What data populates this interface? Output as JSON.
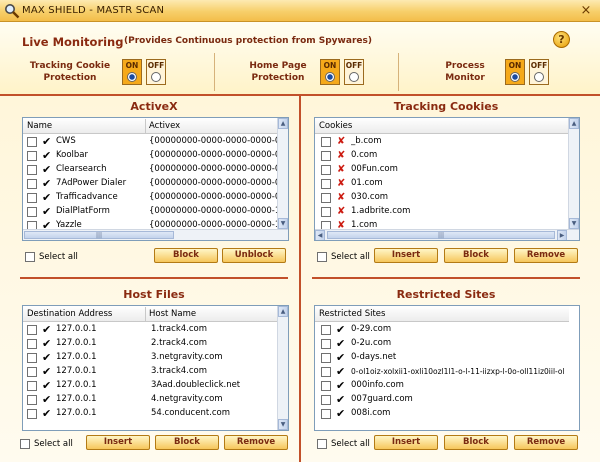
{
  "window": {
    "title": "MAX SHIELD - MASTR SCAN",
    "close_glyph": "×",
    "icon": "magnifier-icon"
  },
  "monitoring": {
    "title": "Live Monitoring",
    "subtitle": "(Provides Continuous protection from Spywares)",
    "help_glyph": "?",
    "toggles": [
      {
        "label_line1": "Tracking Cookie",
        "label_line2": "Protection",
        "on_label": "ON",
        "off_label": "OFF",
        "state": "on"
      },
      {
        "label_line1": "Home Page",
        "label_line2": "Protection",
        "on_label": "ON",
        "off_label": "OFF",
        "state": "on"
      },
      {
        "label_line1": "Process",
        "label_line2": "Monitor",
        "on_label": "ON",
        "off_label": "OFF",
        "state": "on"
      }
    ]
  },
  "activex": {
    "title": "ActiveX",
    "columns": [
      "Name",
      "Activex"
    ],
    "rows": [
      {
        "name": "CWS",
        "value": "{00000000-0000-0000-0000-000"
      },
      {
        "name": "Koolbar",
        "value": "{00000000-0000-0000-0000-000"
      },
      {
        "name": "Clearsearch",
        "value": "{00000000-0000-0000-0000-000"
      },
      {
        "name": "7AdPower Dialer",
        "value": "{00000000-0000-0000-0000-000"
      },
      {
        "name": "Trafficadvance",
        "value": "{00000000-0000-0000-0000-000"
      },
      {
        "name": "DialPlatForm",
        "value": "{00000000-0000-0000-0000-100"
      },
      {
        "name": "Yazzle",
        "value": "{00000000-0000-0000-0000-100"
      }
    ],
    "select_all": "Select all",
    "buttons": [
      "Block",
      "Unblock"
    ]
  },
  "cookies": {
    "title": "Tracking Cookies",
    "columns": [
      "Cookies"
    ],
    "rows": [
      "_b.com",
      "0.com",
      "00Fun.com",
      "01.com",
      "030.com",
      "1.adbrite.com",
      "1.com"
    ],
    "select_all": "Select all",
    "buttons": [
      "Insert",
      "Block",
      "Remove"
    ]
  },
  "hosts": {
    "title": "Host Files",
    "columns": [
      "Destination Address",
      "Host Name"
    ],
    "rows": [
      {
        "addr": "127.0.0.1",
        "host": "1.track4.com"
      },
      {
        "addr": "127.0.0.1",
        "host": "2.track4.com"
      },
      {
        "addr": "127.0.0.1",
        "host": "3.netgravity.com"
      },
      {
        "addr": "127.0.0.1",
        "host": "3.track4.com"
      },
      {
        "addr": "127.0.0.1",
        "host": "3Aad.doubleclick.net"
      },
      {
        "addr": "127.0.0.1",
        "host": "4.netgravity.com"
      },
      {
        "addr": "127.0.0.1",
        "host": "54.conducent.com"
      }
    ],
    "select_all": "Select all",
    "buttons": [
      "Insert",
      "Block",
      "Remove"
    ]
  },
  "restricted": {
    "title": "Restricted Sites",
    "columns": [
      "Restricted Sites"
    ],
    "rows": [
      "0-29.com",
      "0-2u.com",
      "0-days.net",
      "0-ol1oiz-xolxii1-oxli10ozl1l1-o-l-11-iizxp-l-0o-oll11iz0iil-ol",
      "000info.com",
      "007guard.com",
      "008i.com"
    ],
    "select_all": "Select all",
    "buttons": [
      "Insert",
      "Block",
      "Remove"
    ]
  },
  "glyphs": {
    "check": "✔",
    "x": "✘",
    "up": "▲",
    "down": "▼",
    "left": "◀",
    "right": "▶",
    "grip": "|||"
  }
}
